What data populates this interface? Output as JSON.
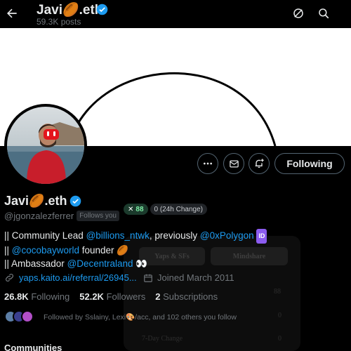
{
  "header": {
    "title": "Javi🏉.eth",
    "posts": "59.3K posts"
  },
  "profile": {
    "display_name": "Javi🏉.eth",
    "handle": "@jgonzalezferrer",
    "follows_you": "Follows you",
    "kaito_score": "88",
    "kaito_change": "0 (24h Change)",
    "following_button": "Following"
  },
  "bio": {
    "l1_prefix": "|| Community Lead ",
    "l1_link1": "@billions_ntwk",
    "l1_mid": ", previously ",
    "l1_link2": "@0xPolygon",
    "l1_badge": "ID",
    "l2_prefix": "|| ",
    "l2_link": "@cocobayworld",
    "l2_suffix": " founder 🏉",
    "l3_prefix": "|| Ambassador ",
    "l3_link": "@Decentraland",
    "l3_suffix": " 👀"
  },
  "meta": {
    "link": "yaps.kaito.ai/referral/26945...",
    "joined": "Joined March 2011"
  },
  "counts": {
    "following_num": "26.8K",
    "following_label": "Following",
    "followers_num": "52.2K",
    "followers_label": "Followers",
    "subs_num": "2",
    "subs_label": "Subscriptions"
  },
  "followed_by": "Followed by Sslainy, Lexi🎨/acc, and 102 others you follow",
  "communities": "Communities",
  "overlay": {
    "tab1": "Yaps & SFs",
    "tab2": "Mindshare",
    "row1_value": "88",
    "row2_value": "0",
    "row3_label": "7-Day Change",
    "row3_value": "0"
  },
  "colors": {
    "link": "#1d9bf0",
    "verified": "#1d9bf0",
    "kaito_green": "#7ef0a6"
  }
}
